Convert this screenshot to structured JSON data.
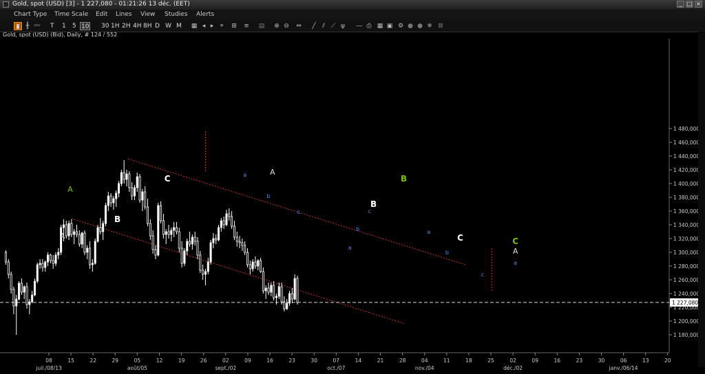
{
  "window": {
    "title": "Gold, spot (USD) [3] - 1 227,080 - 01:21:26  13 déc. (EET)"
  },
  "menu": [
    "Chart Type",
    "Time Scale",
    "Edit",
    "Lines",
    "View",
    "Studies",
    "Alerts"
  ],
  "toolbar": {
    "timeframes": [
      "T",
      "1",
      "5",
      "10",
      "30",
      "1H",
      "2H",
      "4H",
      "8H",
      "D",
      "W",
      "M"
    ],
    "selected_timeframe": "10"
  },
  "info_label": "Gold, spot (USD) (Bid), Daily, # 124 / 552",
  "colors": {
    "background": "#000000",
    "candle_up": "#ffffff",
    "candle_down": "#ffffff",
    "channel": "#c0392b",
    "wave_label_major_green": "#7cc000",
    "wave_label_minor_blue": "#4a90e2",
    "current_price_line": "#ffffff"
  },
  "chart_data": {
    "type": "candlestick",
    "title": "Gold, spot (USD) (Bid), Daily",
    "ylim": [
      1170000,
      1490000
    ],
    "yticks": [
      1180000,
      1200000,
      1220000,
      1240000,
      1260000,
      1280000,
      1300000,
      1320000,
      1340000,
      1360000,
      1380000,
      1400000,
      1420000,
      1440000,
      1460000,
      1480000
    ],
    "ytick_labels": [
      "1 180,000",
      "1 200,000",
      "1 220,000",
      "1 240,000",
      "1 260,000",
      "1 280,000",
      "1 300,000",
      "1 320,000",
      "1 340,000",
      "1 360,000",
      "1 380,000",
      "1 400,000",
      "1 420,000",
      "1 440,000",
      "1 460,000",
      "1 480,000"
    ],
    "xtick_labels": [
      "08",
      "15",
      "22",
      "29",
      "05",
      "12",
      "19",
      "26",
      "02",
      "09",
      "16",
      "23",
      "30",
      "07",
      "14",
      "21",
      "28",
      "04",
      "11",
      "18",
      "25",
      "02",
      "09",
      "16",
      "23",
      "30",
      "06",
      "13",
      "20"
    ],
    "month_labels": [
      {
        "text": "juil./08/13",
        "tick": 0
      },
      {
        "text": "août/05",
        "tick": 4
      },
      {
        "text": "sept./02",
        "tick": 8
      },
      {
        "text": "oct./07",
        "tick": 13
      },
      {
        "text": "nov./04",
        "tick": 17
      },
      {
        "text": "déc./02",
        "tick": 21
      },
      {
        "text": "janv./06/14",
        "tick": 26
      }
    ],
    "current_price": 1227080,
    "current_price_label": "1 227,080",
    "ohlc": [
      [
        1300,
        1303,
        1282,
        1286
      ],
      [
        1286,
        1290,
        1262,
        1268
      ],
      [
        1268,
        1272,
        1240,
        1246
      ],
      [
        1246,
        1250,
        1210,
        1222
      ],
      [
        1222,
        1238,
        1180,
        1232
      ],
      [
        1232,
        1258,
        1230,
        1255
      ],
      [
        1255,
        1262,
        1238,
        1242
      ],
      [
        1242,
        1252,
        1232,
        1250
      ],
      [
        1250,
        1256,
        1218,
        1224
      ],
      [
        1224,
        1232,
        1210,
        1228
      ],
      [
        1228,
        1244,
        1226,
        1238
      ],
      [
        1238,
        1262,
        1236,
        1258
      ],
      [
        1258,
        1285,
        1255,
        1282
      ],
      [
        1282,
        1290,
        1276,
        1284
      ],
      [
        1284,
        1290,
        1272,
        1278
      ],
      [
        1278,
        1288,
        1272,
        1286
      ],
      [
        1286,
        1300,
        1280,
        1296
      ],
      [
        1296,
        1298,
        1284,
        1288
      ],
      [
        1288,
        1296,
        1276,
        1284
      ],
      [
        1284,
        1300,
        1280,
        1296
      ],
      [
        1296,
        1306,
        1290,
        1300
      ],
      [
        1300,
        1340,
        1296,
        1336
      ],
      [
        1336,
        1348,
        1316,
        1340
      ],
      [
        1340,
        1346,
        1320,
        1324
      ],
      [
        1324,
        1346,
        1318,
        1342
      ],
      [
        1342,
        1348,
        1322,
        1326
      ],
      [
        1326,
        1334,
        1312,
        1330
      ],
      [
        1330,
        1340,
        1322,
        1326
      ],
      [
        1326,
        1332,
        1308,
        1312
      ],
      [
        1312,
        1330,
        1306,
        1328
      ],
      [
        1328,
        1332,
        1296,
        1300
      ],
      [
        1300,
        1310,
        1290,
        1306
      ],
      [
        1306,
        1316,
        1276,
        1282
      ],
      [
        1282,
        1290,
        1272,
        1284
      ],
      [
        1284,
        1320,
        1282,
        1316
      ],
      [
        1316,
        1340,
        1314,
        1336
      ],
      [
        1336,
        1350,
        1326,
        1330
      ],
      [
        1330,
        1346,
        1318,
        1342
      ],
      [
        1342,
        1372,
        1338,
        1368
      ],
      [
        1368,
        1388,
        1360,
        1382
      ],
      [
        1382,
        1386,
        1366,
        1372
      ],
      [
        1372,
        1382,
        1362,
        1378
      ],
      [
        1378,
        1390,
        1366,
        1386
      ],
      [
        1386,
        1404,
        1380,
        1400
      ],
      [
        1400,
        1420,
        1396,
        1416
      ],
      [
        1416,
        1434,
        1400,
        1406
      ],
      [
        1406,
        1420,
        1396,
        1414
      ],
      [
        1414,
        1418,
        1388,
        1394
      ],
      [
        1394,
        1402,
        1376,
        1382
      ],
      [
        1382,
        1398,
        1376,
        1394
      ],
      [
        1394,
        1416,
        1388,
        1410
      ],
      [
        1410,
        1414,
        1372,
        1376
      ],
      [
        1376,
        1392,
        1360,
        1388
      ],
      [
        1388,
        1396,
        1362,
        1366
      ],
      [
        1366,
        1378,
        1338,
        1342
      ],
      [
        1342,
        1348,
        1318,
        1324
      ],
      [
        1324,
        1332,
        1298,
        1304
      ],
      [
        1304,
        1310,
        1290,
        1296
      ],
      [
        1296,
        1372,
        1294,
        1368
      ],
      [
        1368,
        1374,
        1342,
        1346
      ],
      [
        1346,
        1356,
        1320,
        1326
      ],
      [
        1326,
        1334,
        1312,
        1330
      ],
      [
        1330,
        1340,
        1320,
        1326
      ],
      [
        1326,
        1336,
        1316,
        1332
      ],
      [
        1332,
        1344,
        1322,
        1336
      ],
      [
        1336,
        1344,
        1326,
        1330
      ],
      [
        1330,
        1336,
        1300,
        1306
      ],
      [
        1306,
        1316,
        1278,
        1284
      ],
      [
        1284,
        1306,
        1280,
        1302
      ],
      [
        1302,
        1320,
        1296,
        1316
      ],
      [
        1316,
        1330,
        1308,
        1312
      ],
      [
        1312,
        1326,
        1304,
        1322
      ],
      [
        1322,
        1330,
        1310,
        1316
      ],
      [
        1316,
        1322,
        1290,
        1296
      ],
      [
        1296,
        1302,
        1270,
        1274
      ],
      [
        1274,
        1282,
        1260,
        1268
      ],
      [
        1268,
        1276,
        1252,
        1272
      ],
      [
        1272,
        1292,
        1268,
        1286
      ],
      [
        1286,
        1318,
        1282,
        1314
      ],
      [
        1314,
        1328,
        1306,
        1320
      ],
      [
        1320,
        1326,
        1312,
        1318
      ],
      [
        1318,
        1340,
        1316,
        1336
      ],
      [
        1336,
        1350,
        1330,
        1346
      ],
      [
        1346,
        1352,
        1334,
        1340
      ],
      [
        1340,
        1362,
        1338,
        1356
      ],
      [
        1356,
        1364,
        1346,
        1352
      ],
      [
        1352,
        1360,
        1334,
        1338
      ],
      [
        1338,
        1346,
        1318,
        1322
      ],
      [
        1322,
        1330,
        1308,
        1316
      ],
      [
        1316,
        1324,
        1306,
        1314
      ],
      [
        1314,
        1320,
        1302,
        1310
      ],
      [
        1310,
        1316,
        1296,
        1300
      ],
      [
        1300,
        1306,
        1278,
        1282
      ],
      [
        1282,
        1288,
        1268,
        1276
      ],
      [
        1276,
        1290,
        1272,
        1286
      ],
      [
        1286,
        1294,
        1276,
        1280
      ],
      [
        1280,
        1290,
        1274,
        1288
      ],
      [
        1288,
        1292,
        1270,
        1272
      ],
      [
        1272,
        1278,
        1240,
        1244
      ],
      [
        1244,
        1252,
        1232,
        1248
      ],
      [
        1248,
        1256,
        1238,
        1242
      ],
      [
        1242,
        1256,
        1236,
        1252
      ],
      [
        1252,
        1258,
        1230,
        1234
      ],
      [
        1234,
        1240,
        1224,
        1236
      ],
      [
        1236,
        1256,
        1232,
        1250
      ],
      [
        1250,
        1256,
        1224,
        1228
      ],
      [
        1228,
        1236,
        1214,
        1218
      ],
      [
        1218,
        1232,
        1216,
        1226
      ],
      [
        1226,
        1244,
        1222,
        1240
      ],
      [
        1240,
        1248,
        1226,
        1232
      ],
      [
        1232,
        1268,
        1230,
        1262
      ],
      [
        1262,
        1266,
        1224,
        1227
      ]
    ],
    "channel_lines": [
      {
        "from": {
          "bar": 46.5,
          "price": 1436
        },
        "to": {
          "bar": 175,
          "price": 1282
        }
      },
      {
        "from": {
          "bar": 25,
          "price": 1349
        },
        "to": {
          "bar": 152,
          "price": 1196
        }
      }
    ],
    "annotations": [
      {
        "text": "A",
        "bar": 24.5,
        "price": 1388,
        "color": "#7cc000",
        "size": 11
      },
      {
        "text": "A",
        "bar": 21.5,
        "price": 1320,
        "color": "#dddddd",
        "size": 11
      },
      {
        "text": "B",
        "bar": 42.5,
        "price": 1344,
        "color": "#ffffff",
        "size": 12,
        "bold": true
      },
      {
        "text": "C",
        "bar": 61.5,
        "price": 1403,
        "color": "#ffffff",
        "size": 12,
        "bold": true
      },
      {
        "text": "A",
        "bar": 101.5,
        "price": 1413,
        "color": "#dddddd",
        "size": 11
      },
      {
        "text": "B",
        "bar": 151.5,
        "price": 1403,
        "color": "#7cc000",
        "size": 12,
        "bold": true
      },
      {
        "text": "B",
        "bar": 140,
        "price": 1366,
        "color": "#ffffff",
        "size": 12,
        "bold": true
      },
      {
        "text": "C",
        "bar": 173,
        "price": 1317,
        "color": "#ffffff",
        "size": 12,
        "bold": true
      },
      {
        "text": "C",
        "bar": 194,
        "price": 1312,
        "color": "#7cc000",
        "size": 12,
        "bold": true
      },
      {
        "text": "A",
        "bar": 194,
        "price": 1298,
        "color": "#dddddd",
        "size": 11
      },
      {
        "text": "a",
        "bar": 91,
        "price": 1410,
        "color": "#4a90e2",
        "size": 8
      },
      {
        "text": "b",
        "bar": 100,
        "price": 1379,
        "color": "#4a90e2",
        "size": 8
      },
      {
        "text": "c",
        "bar": 111.5,
        "price": 1356,
        "color": "#4a90e2",
        "size": 8
      },
      {
        "text": "a",
        "bar": 131,
        "price": 1304,
        "color": "#4a90e2",
        "size": 8
      },
      {
        "text": "b",
        "bar": 134,
        "price": 1331,
        "color": "#4a90e2",
        "size": 8
      },
      {
        "text": "c",
        "bar": 138.5,
        "price": 1357,
        "color": "#4a90e2",
        "size": 8
      },
      {
        "text": "a",
        "bar": 161,
        "price": 1327,
        "color": "#4a90e2",
        "size": 8
      },
      {
        "text": "b",
        "bar": 168,
        "price": 1297,
        "color": "#4a90e2",
        "size": 8
      },
      {
        "text": "c",
        "bar": 181.5,
        "price": 1265,
        "color": "#4a90e2",
        "size": 8
      },
      {
        "text": "a",
        "bar": 194,
        "price": 1282,
        "color": "#4a90e2",
        "size": 8
      }
    ],
    "vertical_markers": [
      {
        "bar": 76,
        "top": 1476,
        "bottom": 1416
      },
      {
        "bar": 185,
        "top": 1306,
        "bottom": 1242
      }
    ]
  }
}
